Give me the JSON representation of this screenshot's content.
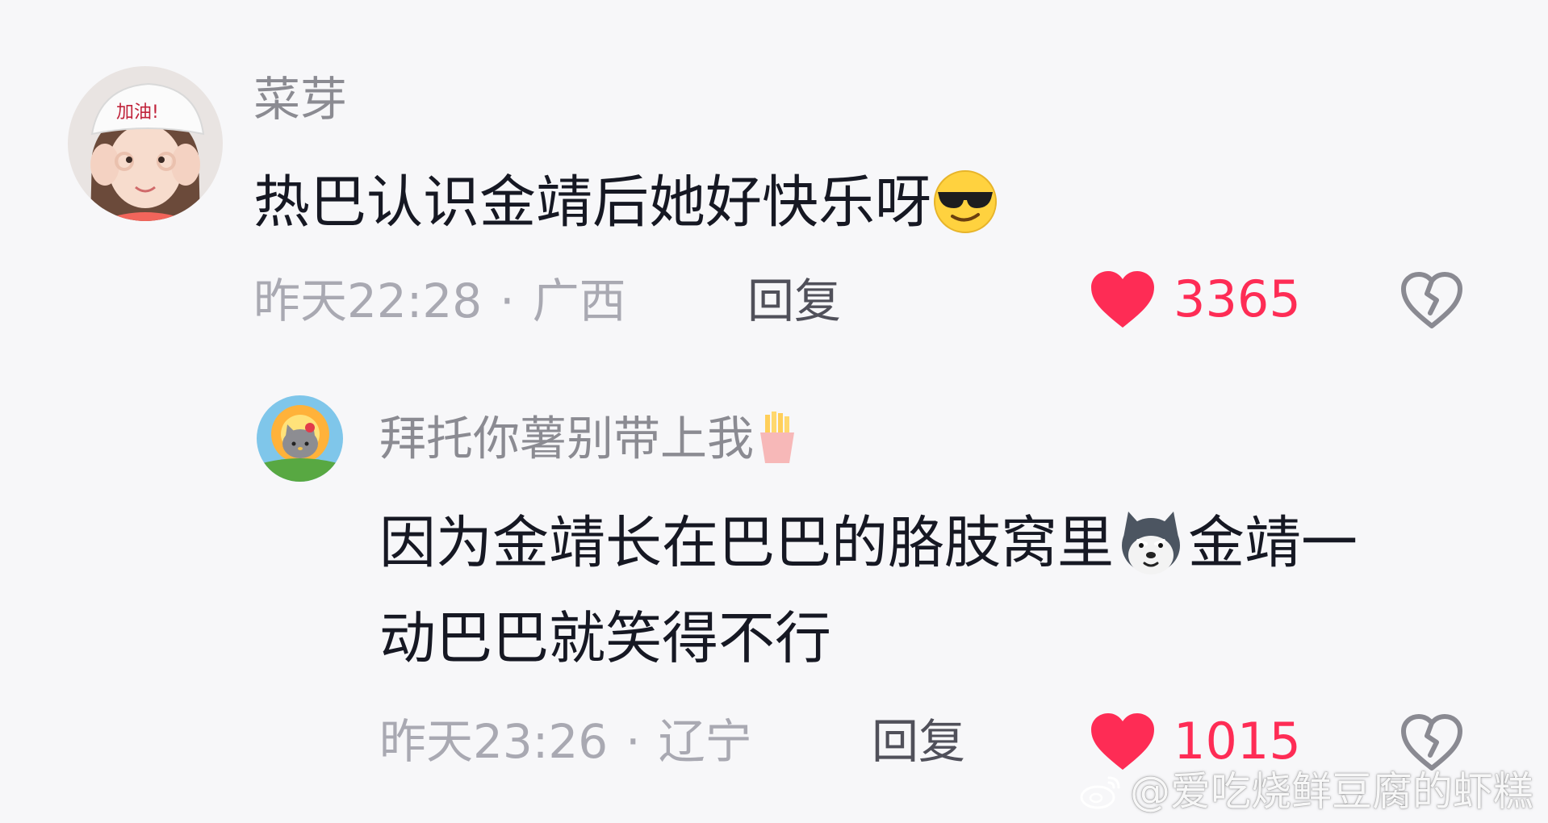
{
  "comments": [
    {
      "username": "菜芽",
      "text": "热巴认识金靖后她好快乐呀",
      "text_emoji": "sunglasses-emoji",
      "avatar_badge": "加油!",
      "time": "昨天22:28",
      "location": "广西",
      "separator": "·",
      "reply_label": "回复",
      "like_count": "3365"
    },
    {
      "username": "拜托你薯别带上我",
      "username_emoji": "fries-emoji",
      "text_line1_part1": "因为金靖长在巴巴的胳肢窝里",
      "text_line1_emoji": "husky-emoji",
      "text_line1_part2": "金靖一",
      "text_line2": "动巴巴就笑得不行",
      "time": "昨天23:26",
      "location": "辽宁",
      "separator": "·",
      "reply_label": "回复",
      "like_count": "1015"
    }
  ],
  "watermark": {
    "icon": "weibo-logo-icon",
    "text": "@爱吃烧鲜豆腐的虾糕"
  },
  "colors": {
    "background": "#f7f7f9",
    "text": "#161823",
    "username": "#8b8b92",
    "meta": "#a9a9b2",
    "like": "#fe2c55"
  }
}
